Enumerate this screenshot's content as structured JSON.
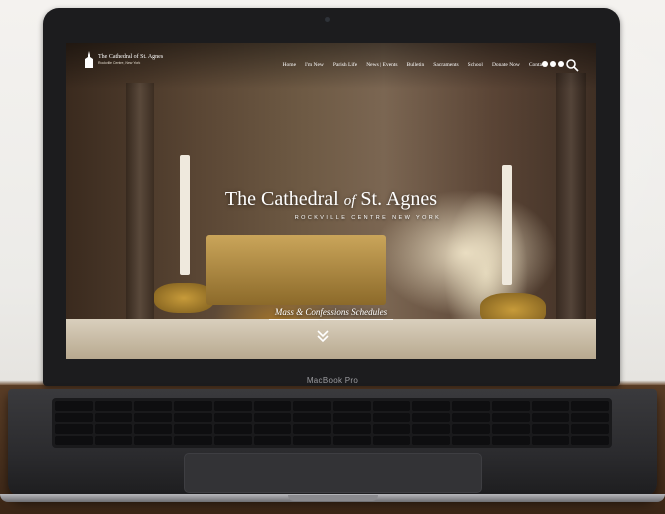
{
  "device": {
    "label": "MacBook Pro"
  },
  "site": {
    "logo": {
      "title": "The Cathedral of St. Agnes",
      "subtitle": "Rockville Centre, New York"
    },
    "nav": {
      "items": [
        "Home",
        "I'm New",
        "Parish Life",
        "News | Events",
        "Bulletin",
        "Sacraments",
        "School",
        "Donate Now",
        "Contact"
      ]
    },
    "icons": {
      "social": [
        "facebook-icon",
        "instagram-icon",
        "youtube-icon"
      ],
      "search": "search-icon",
      "scroll": "chevron-down-icon"
    },
    "hero": {
      "title_part1": "The Cathedral",
      "title_of": "of",
      "title_part2": "St. Agnes",
      "subtitle": "ROCKVILLE CENTRE NEW YORK",
      "cta": "Mass & Confessions Schedules"
    }
  },
  "colors": {
    "bezel": "#1c1c1e",
    "nav_text": "#ffffff",
    "hero_text": "#ffffff"
  }
}
